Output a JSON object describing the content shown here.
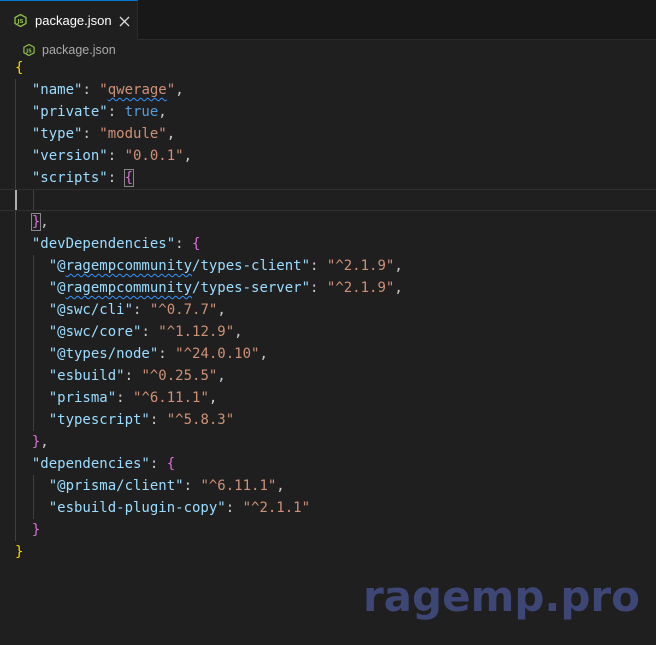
{
  "tab": {
    "icon": "js-file-icon",
    "label": "package.json",
    "close_icon": "close-icon"
  },
  "breadcrumb": {
    "icon": "js-file-icon",
    "label": "package.json"
  },
  "colors": {
    "key": "#9cdcfe",
    "string": "#ce9178",
    "boolean": "#569cd6",
    "bracket_level_1": "#ffd700",
    "bracket_level_2": "#da70d6",
    "bracket_level_3": "#179fff",
    "tab_accent": "#0078d4",
    "js_icon": "#8dc149"
  },
  "code": {
    "open_root": "{",
    "name_key": "\"name\"",
    "name_value": "\"qwerage\"",
    "private_key": "\"private\"",
    "private_value": "true",
    "type_key": "\"type\"",
    "type_value": "\"module\"",
    "version_key": "\"version\"",
    "version_value": "\"0.0.1\"",
    "scripts_key": "\"scripts\"",
    "scripts_open": "{",
    "scripts_close": "}",
    "dev_key": "\"devDependencies\"",
    "dev_open": "{",
    "dev_items": [
      {
        "prefix": "\"@",
        "spell": "ragempcommunity",
        "suffix": "/types-client\"",
        "value": "\"^2.1.9\"",
        "comma": ","
      },
      {
        "prefix": "\"@",
        "spell": "ragempcommunity",
        "suffix": "/types-server\"",
        "value": "\"^2.1.9\"",
        "comma": ","
      },
      {
        "prefix": "\"@swc/cli\"",
        "spell": "",
        "suffix": "",
        "value": "\"^0.7.7\"",
        "comma": ","
      },
      {
        "prefix": "\"@swc/core\"",
        "spell": "",
        "suffix": "",
        "value": "\"^1.12.9\"",
        "comma": ","
      },
      {
        "prefix": "\"@types/node\"",
        "spell": "",
        "suffix": "",
        "value": "\"^24.0.10\"",
        "comma": ","
      },
      {
        "prefix": "\"esbuild\"",
        "spell": "",
        "suffix": "",
        "value": "\"^0.25.5\"",
        "comma": ","
      },
      {
        "prefix": "\"prisma\"",
        "spell": "",
        "suffix": "",
        "value": "\"^6.11.1\"",
        "comma": ","
      },
      {
        "prefix": "\"typescript\"",
        "spell": "",
        "suffix": "",
        "value": "\"^5.8.3\"",
        "comma": ""
      }
    ],
    "dev_close": "}",
    "deps_key": "\"dependencies\"",
    "deps_open": "{",
    "deps_items": [
      {
        "key": "\"@prisma/client\"",
        "value": "\"^6.11.1\"",
        "comma": ","
      },
      {
        "key": "\"esbuild-plugin-copy\"",
        "value": "\"^2.1.1\"",
        "comma": ""
      }
    ],
    "deps_close": "}",
    "close_root": "}"
  },
  "watermark": "ragemp.pro"
}
